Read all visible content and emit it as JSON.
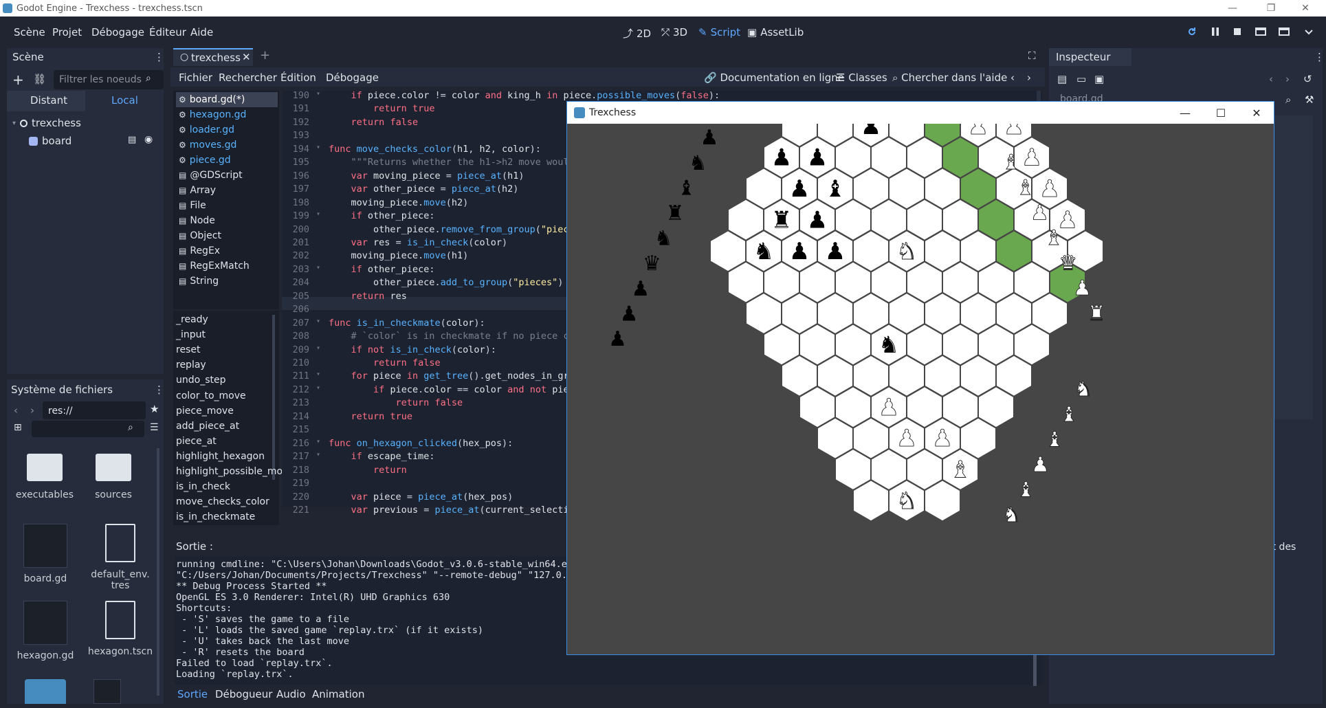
{
  "window": {
    "title": "Godot Engine - Trexchess - trexchess.tscn",
    "minimize": "—",
    "maximize": "❐",
    "close": "✕"
  },
  "menu": [
    "Scène",
    "Projet",
    "Débogage",
    "Éditeur",
    "Aide"
  ],
  "workspaces": [
    {
      "label": "2D",
      "icon": "2d-icon"
    },
    {
      "label": "3D",
      "icon": "3d-icon"
    },
    {
      "label": "Script",
      "icon": "script-icon",
      "active": true
    },
    {
      "label": "AssetLib",
      "icon": "assetlib-icon"
    }
  ],
  "scene_panel": {
    "title": "Scène",
    "filter_placeholder": "Filtrer les noeuds",
    "tabs": [
      "Distant",
      "Local"
    ],
    "tree": [
      {
        "label": "trexchess",
        "icon": "node-icon"
      },
      {
        "label": "board",
        "icon": "sprite-icon"
      }
    ]
  },
  "filesystem": {
    "title": "Système de fichiers",
    "path": "res://",
    "items": [
      {
        "label": "executables",
        "type": "folder"
      },
      {
        "label": "sources",
        "type": "folder"
      },
      {
        "label": "board.gd",
        "type": "script"
      },
      {
        "label": "default_env.tres",
        "type": "resource"
      },
      {
        "label": "hexagon.gd",
        "type": "script"
      },
      {
        "label": "hexagon.tscn",
        "type": "scene"
      }
    ]
  },
  "script_editor": {
    "tab_label": "trexchess",
    "menus": [
      "Fichier",
      "Rechercher",
      "Édition",
      "Débogage"
    ],
    "help_links": [
      "Documentation en ligne",
      "Classes",
      "Chercher dans l'aide"
    ],
    "scripts": [
      "board.gd(*)",
      "hexagon.gd",
      "loader.gd",
      "moves.gd",
      "piece.gd",
      "@GDScript",
      "Array",
      "File",
      "Node",
      "Object",
      "RegEx",
      "RegExMatch",
      "String"
    ],
    "methods": [
      "_ready",
      "_input",
      "reset",
      "replay",
      "undo_step",
      "color_to_move",
      "piece_move",
      "add_piece_at",
      "piece_at",
      "highlight_hexagon",
      "highlight_possible_mov",
      "is_in_check",
      "move_checks_color",
      "is_in_checkmate"
    ],
    "code": [
      {
        "n": "190",
        "t": "    if piece.color != color and king_h in piece.possible_moves(false):"
      },
      {
        "n": "191",
        "t": "        return true"
      },
      {
        "n": "192",
        "t": "    return false"
      },
      {
        "n": "193",
        "t": ""
      },
      {
        "n": "194",
        "t": "func move_checks_color(h1, h2, color):"
      },
      {
        "n": "195",
        "t": "    \"\"\"Returns whether the h1->h2 move would"
      },
      {
        "n": "196",
        "t": "    var moving_piece = piece_at(h1)"
      },
      {
        "n": "197",
        "t": "    var other_piece = piece_at(h2)"
      },
      {
        "n": "198",
        "t": "    moving_piece.move(h2)"
      },
      {
        "n": "199",
        "t": "    if other_piece:"
      },
      {
        "n": "200",
        "t": "        other_piece.remove_from_group(\"piece"
      },
      {
        "n": "201",
        "t": "    var res = is_in_check(color)"
      },
      {
        "n": "202",
        "t": "    moving_piece.move(h1)"
      },
      {
        "n": "203",
        "t": "    if other_piece:"
      },
      {
        "n": "204",
        "t": "        other_piece.add_to_group(\"pieces\")"
      },
      {
        "n": "205",
        "t": "    return res"
      },
      {
        "n": "206",
        "t": ""
      },
      {
        "n": "207",
        "t": "func is_in_checkmate(color):"
      },
      {
        "n": "208",
        "t": "    # `color` is in checkmate if no piece ca"
      },
      {
        "n": "209",
        "t": "    if not is_in_check(color):"
      },
      {
        "n": "210",
        "t": "        return false"
      },
      {
        "n": "211",
        "t": "    for piece in get_tree().get_nodes_in_gro"
      },
      {
        "n": "212",
        "t": "        if piece.color == color and not piec"
      },
      {
        "n": "213",
        "t": "            return false"
      },
      {
        "n": "214",
        "t": "    return true"
      },
      {
        "n": "215",
        "t": ""
      },
      {
        "n": "216",
        "t": "func on_hexagon_clicked(hex_pos):"
      },
      {
        "n": "217",
        "t": "    if escape_time:"
      },
      {
        "n": "218",
        "t": "        return"
      },
      {
        "n": "219",
        "t": ""
      },
      {
        "n": "220",
        "t": "    var piece = piece_at(hex_pos)"
      },
      {
        "n": "221",
        "t": "    var previous = piece_at(current_selectio"
      }
    ]
  },
  "output": {
    "title": "Sortie :",
    "lines": [
      "running cmdline: \"C:\\Users\\Johan\\Downloads\\Godot_v3.0.6-stable_win64.ex",
      "\"C:/Users/Johan/Documents/Projects/Trexchess\" \"--remote-debug\" \"127.0.0",
      "** Debug Process Started **",
      "OpenGL ES 3.0 Renderer: Intel(R) UHD Graphics 630",
      "Shortcuts:",
      " - 'S' saves the game to a file",
      " - 'L' loads the saved game `replay.trx` (if it exists)",
      " - 'U' takes back the last move",
      " - 'R' resets the board",
      "Failed to load `replay.trx`.",
      "Loading `replay.trx`."
    ],
    "bottom_tabs": [
      "Sortie",
      "Débogueur",
      "Audio",
      "Animation"
    ]
  },
  "inspector": {
    "title": "Inspecteur",
    "field": "board.gd",
    "fragment": "et des"
  },
  "game_window": {
    "title": "Trexchess",
    "highlight_color": "#6aa84f",
    "pieces": [
      {
        "q": -1,
        "r": -4,
        "p": "queen",
        "c": "white"
      },
      {
        "q": 2,
        "r": -4,
        "p": "rook",
        "c": "white"
      },
      {
        "q": 5,
        "r": -3,
        "p": "knight",
        "c": "white"
      },
      {
        "q": -4,
        "r": -1,
        "p": "king",
        "c": "black"
      },
      {
        "q": 1,
        "r": -1,
        "p": "pawn",
        "c": "black"
      },
      {
        "q": 4,
        "r": -1,
        "p": "pawn",
        "c": "white"
      },
      {
        "q": 5,
        "r": -1,
        "p": "pawn",
        "c": "white"
      },
      {
        "q": 6,
        "r": -1,
        "p": "bishop",
        "c": "white"
      },
      {
        "q": -2,
        "r": 0,
        "p": "pawn",
        "c": "black"
      },
      {
        "q": -1,
        "r": 0,
        "p": "pawn",
        "c": "black"
      },
      {
        "q": 5,
        "r": 0,
        "p": "pawn",
        "c": "white"
      },
      {
        "q": 7,
        "r": 0,
        "p": "king",
        "c": "white"
      },
      {
        "q": -2,
        "r": 1,
        "p": "pawn",
        "c": "black"
      },
      {
        "q": -1,
        "r": 1,
        "p": "bishop",
        "c": "black"
      },
      {
        "q": 5,
        "r": 1,
        "p": "pawn",
        "c": "white"
      },
      {
        "q": 6,
        "r": 1,
        "p": "bishop",
        "c": "white"
      },
      {
        "q": -2,
        "r": 2,
        "p": "pawn",
        "c": "black"
      },
      {
        "q": -3,
        "r": 2,
        "p": "rook",
        "c": "black"
      },
      {
        "q": 5,
        "r": 2,
        "p": "pawn",
        "c": "white"
      },
      {
        "q": 7,
        "r": 2,
        "p": "rook",
        "c": "white"
      },
      {
        "q": -4,
        "r": 3,
        "p": "knight",
        "c": "black"
      },
      {
        "q": -3,
        "r": 3,
        "p": "pawn",
        "c": "black"
      },
      {
        "q": -2,
        "r": 3,
        "p": "pawn",
        "c": "black"
      },
      {
        "q": 0,
        "r": 3,
        "p": "knight",
        "c": "white"
      },
      {
        "q": 9,
        "r": 3,
        "p": "knight",
        "c": "white"
      },
      {
        "q": 6,
        "r": 4,
        "p": "pawn",
        "c": "white"
      },
      {
        "q": 8,
        "r": 4,
        "p": "knight",
        "c": "white"
      },
      {
        "q": -2,
        "r": 6,
        "p": "knight",
        "c": "black"
      },
      {
        "q": -3,
        "r": 8,
        "p": "pawn",
        "c": "white"
      },
      {
        "q": 1,
        "r": 8,
        "p": "pawn",
        "c": "white"
      },
      {
        "q": 2,
        "r": 8,
        "p": "knight",
        "c": "white"
      },
      {
        "q": 3,
        "r": 8,
        "p": "pawn",
        "c": "white"
      },
      {
        "q": -3,
        "r": 9,
        "p": "pawn",
        "c": "white"
      },
      {
        "q": -2,
        "r": 9,
        "p": "pawn",
        "c": "white"
      },
      {
        "q": 0,
        "r": 9,
        "p": "pawn",
        "c": "white"
      },
      {
        "q": -2,
        "r": 10,
        "p": "bishop",
        "c": "white"
      },
      {
        "q": 0,
        "r": 10,
        "p": "bishop",
        "c": "white"
      },
      {
        "q": 2,
        "r": 10,
        "p": "pawn",
        "c": "white"
      },
      {
        "q": -4,
        "r": 11,
        "p": "knight",
        "c": "white"
      },
      {
        "q": -1,
        "r": 11,
        "p": "king",
        "c": "white"
      },
      {
        "q": 2,
        "r": 11,
        "p": "rook",
        "c": "white"
      },
      {
        "q": 3,
        "r": 11,
        "p": "knight",
        "c": "white"
      }
    ],
    "highlighted": [
      [
        1,
        -4
      ],
      [
        2,
        -4
      ],
      [
        -4,
        -3
      ],
      [
        -3,
        -3
      ],
      [
        -2,
        -3
      ],
      [
        -1,
        -3
      ],
      [
        1,
        -3
      ],
      [
        2,
        -3
      ],
      [
        3,
        -3
      ],
      [
        4,
        -3
      ],
      [
        0,
        -2
      ],
      [
        1,
        -2
      ],
      [
        3,
        -1
      ],
      [
        3,
        0
      ],
      [
        3,
        1
      ],
      [
        3,
        2
      ],
      [
        3,
        3
      ],
      [
        4,
        4
      ]
    ],
    "captured_black": [
      "pawn",
      "knight",
      "bishop",
      "rook",
      "knight",
      "queen",
      "pawn",
      "pawn",
      "pawn"
    ],
    "captured_white": [
      "bishop",
      "bishop",
      "pawn",
      "bishop",
      "queen",
      "pawn",
      "rook",
      "knight",
      "bishop",
      "bishop",
      "pawn",
      "bishop",
      "knight"
    ]
  }
}
